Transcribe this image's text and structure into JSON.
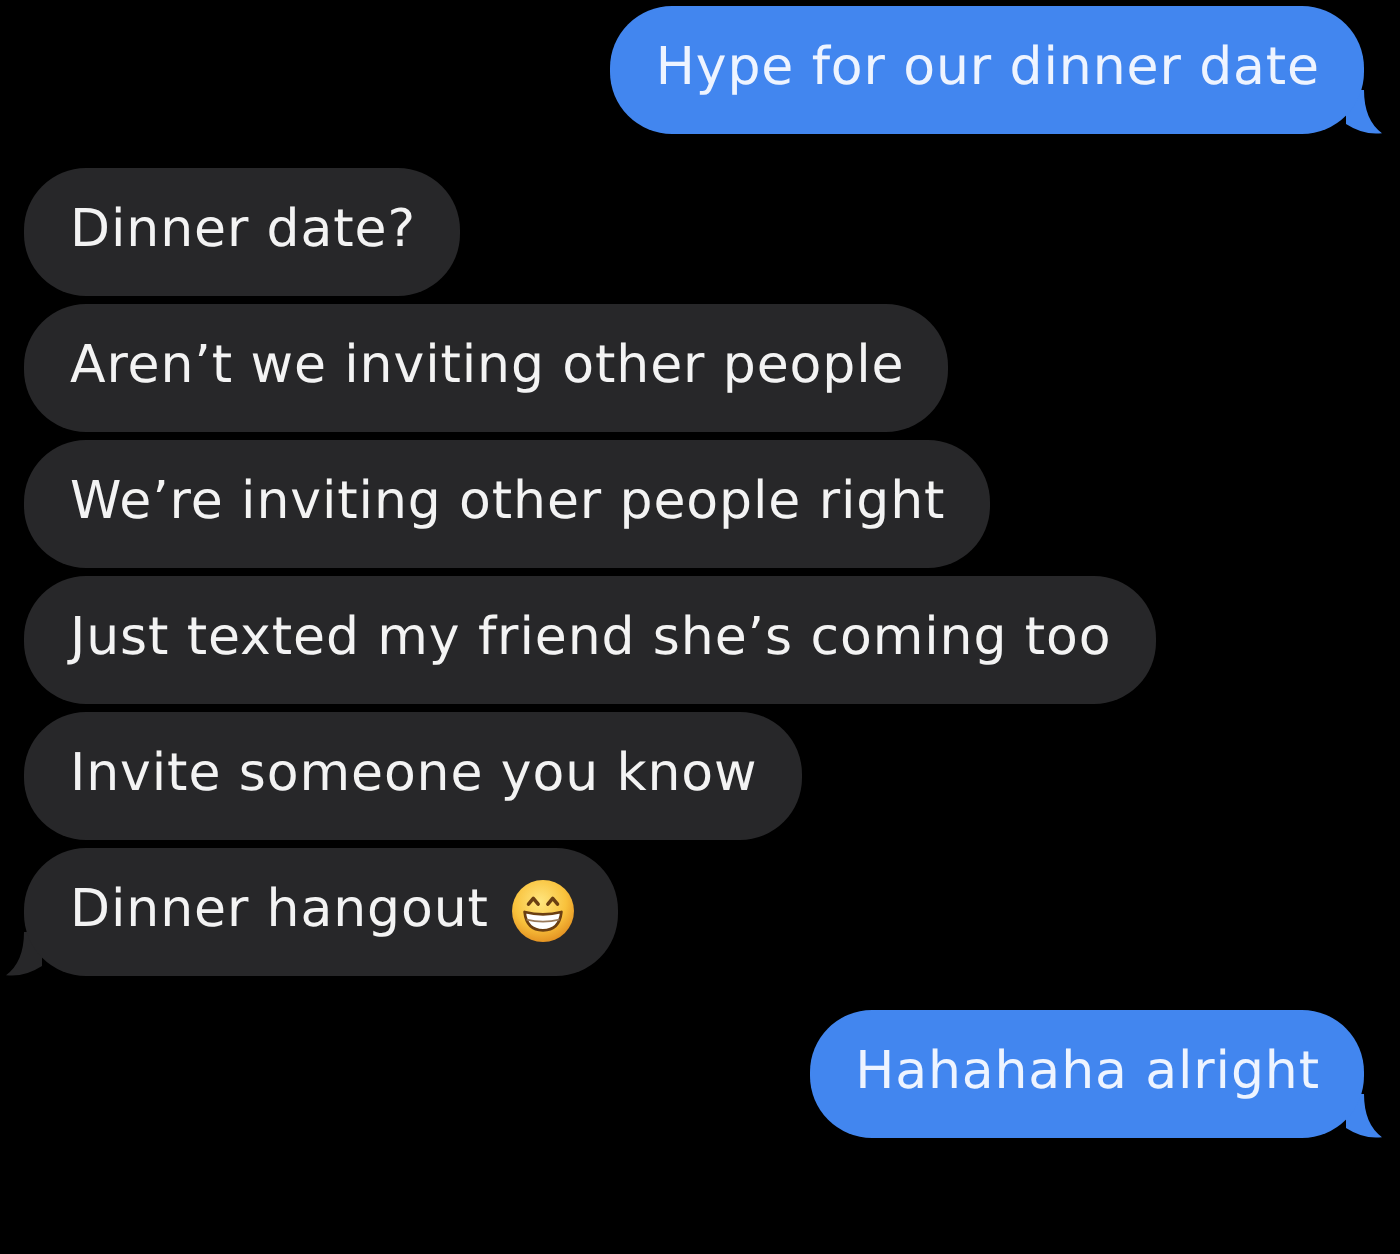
{
  "messages": [
    {
      "kind": "sent",
      "text": "Hype for our dinner date",
      "tail": true,
      "emoji": false
    },
    {
      "kind": "received",
      "text": "Dinner date?",
      "tail": false,
      "emoji": false
    },
    {
      "kind": "received",
      "text": "Aren’t we inviting other people",
      "tail": false,
      "emoji": false
    },
    {
      "kind": "received",
      "text": "We’re inviting other people right",
      "tail": false,
      "emoji": false
    },
    {
      "kind": "received",
      "text": "Just texted my friend she’s coming too",
      "tail": false,
      "emoji": false
    },
    {
      "kind": "received",
      "text": "Invite someone you know",
      "tail": false,
      "emoji": false
    },
    {
      "kind": "received",
      "text": "Dinner hangout",
      "tail": true,
      "emoji": true
    },
    {
      "kind": "sent",
      "text": "Hahahaha alright",
      "tail": true,
      "emoji": false
    }
  ]
}
